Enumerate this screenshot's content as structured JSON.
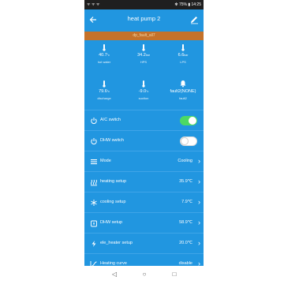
{
  "statusbar": {
    "left": "ᯤ ᯤ ᯤ",
    "right": "✻ 75% ▮ 14:25"
  },
  "appbar": {
    "title": "heat pump 2",
    "back_icon": "arrow-left-icon",
    "edit_icon": "pencil-icon"
  },
  "fault_banner": "dp_fault_all7",
  "sensors_row1": [
    {
      "icon": "thermometer-icon",
      "value": "40.7",
      "unit": "°c",
      "label": "hot water"
    },
    {
      "icon": "thermometer-icon",
      "value": "34.2",
      "unit": "bar",
      "label": "HPS"
    },
    {
      "icon": "thermometer-icon",
      "value": "6.6",
      "unit": "bar",
      "label": "LPS"
    }
  ],
  "sensors_row2": [
    {
      "icon": "thermometer-icon",
      "value": "79.6",
      "unit": "°c",
      "label": "discharge"
    },
    {
      "icon": "thermometer-icon",
      "value": "-9.0",
      "unit": "°c",
      "label": "suction"
    },
    {
      "icon": "bell-icon",
      "value": "fault2(NONE)",
      "unit": "",
      "label": "fault2"
    }
  ],
  "rows": {
    "ac_switch": {
      "label": "A/C switch",
      "on": true
    },
    "dhw_switch": {
      "label": "DHW switch",
      "on": false
    },
    "mode": {
      "label": "Mode",
      "value": "Cooling"
    },
    "heating_setup": {
      "label": "heating setup",
      "value": "35.9℃"
    },
    "cooling_setup": {
      "label": "cooling  setup",
      "value": "7.9℃"
    },
    "dhw_setup": {
      "label": "DHW setup",
      "value": "58.9℃"
    },
    "ele_heater_setup": {
      "label": "ele_heater setup",
      "value": "20.0℃"
    },
    "heating_curve": {
      "label": "Heating curve",
      "value": "disable"
    }
  },
  "colors": {
    "primary": "#2196e0",
    "fault": "#c5722a",
    "toggle_on": "#4cd964",
    "toggle_off": "#ffffff"
  },
  "navbar": {
    "back": "◁",
    "home": "○",
    "recents": "□"
  }
}
